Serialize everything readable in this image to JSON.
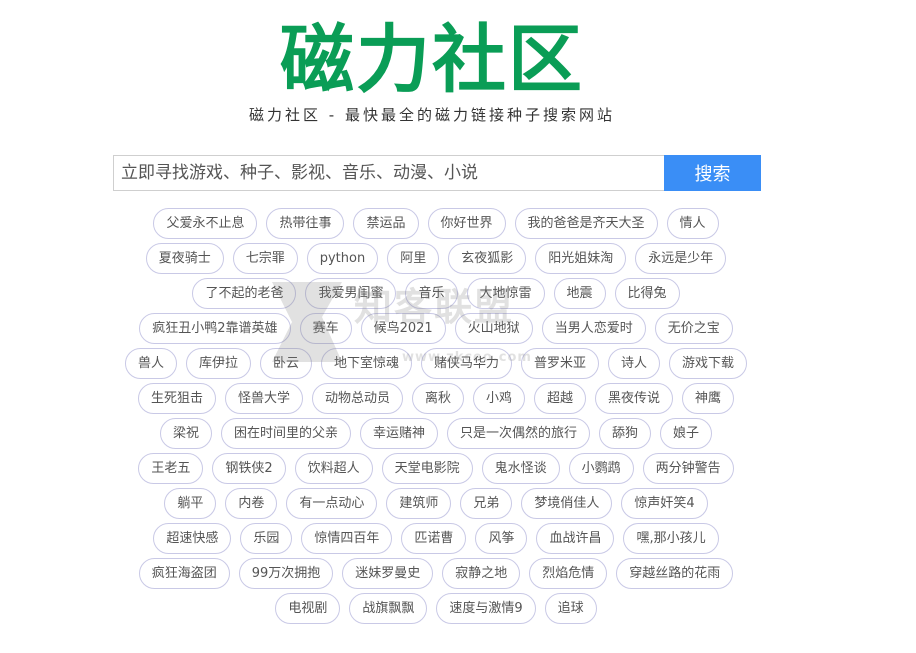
{
  "header": {
    "logo": "磁力社区",
    "tagline": "磁力社区 - 最快最全的磁力链接种子搜索网站"
  },
  "search": {
    "placeholder": "立即寻找游戏、种子、影视、音乐、动漫、小说",
    "button_label": "搜索"
  },
  "tag_rows": [
    [
      "父爱永不止息",
      "热带往事",
      "禁运品",
      "你好世界",
      "我的爸爸是齐天大圣",
      "情人"
    ],
    [
      "夏夜骑士",
      "七宗罪",
      "python",
      "阿里",
      "玄夜狐影",
      "阳光姐妹淘",
      "永远是少年"
    ],
    [
      "了不起的老爸",
      "我爱男闺蜜",
      "音乐",
      "大地惊雷",
      "地震",
      "比得兔"
    ],
    [
      "疯狂丑小鸭2靠谱英雄",
      "赛车",
      "候鸟2021",
      "火山地狱",
      "当男人恋爱时",
      "无价之宝"
    ],
    [
      "兽人",
      "库伊拉",
      "卧云",
      "地下室惊魂",
      "赌侠马华力",
      "普罗米亚",
      "诗人",
      "游戏下载"
    ],
    [
      "生死狙击",
      "怪兽大学",
      "动物总动员",
      "离秋",
      "小鸡",
      "超越",
      "黑夜传说",
      "神鹰"
    ],
    [
      "梁祝",
      "困在时间里的父亲",
      "幸运赌神",
      "只是一次偶然的旅行",
      "舔狗",
      "娘子"
    ],
    [
      "王老五",
      "钢铁侠2",
      "饮料超人",
      "天堂电影院",
      "鬼水怪谈",
      "小鹦鹉",
      "两分钟警告"
    ],
    [
      "躺平",
      "内卷",
      "有一点动心",
      "建筑师",
      "兄弟",
      "梦境俏佳人",
      "惊声奸笑4"
    ],
    [
      "超速快感",
      "乐园",
      "惊情四百年",
      "匹诺曹",
      "风筝",
      "血战许昌",
      "嘿,那小孩儿"
    ],
    [
      "疯狂海盗团",
      "99万次拥抱",
      "迷妹罗曼史",
      "寂静之地",
      "烈焰危情",
      "穿越丝路的花雨"
    ],
    [
      "电视剧",
      "战旗飘飘",
      "速度与激情9",
      "追球"
    ]
  ],
  "watermark": {
    "text": "知客联盟",
    "sub": "www.zkceo.com"
  },
  "colors": {
    "logo": "#0a9d56",
    "search_button": "#3a8ef6",
    "tag_border": "#c9c9e6"
  }
}
